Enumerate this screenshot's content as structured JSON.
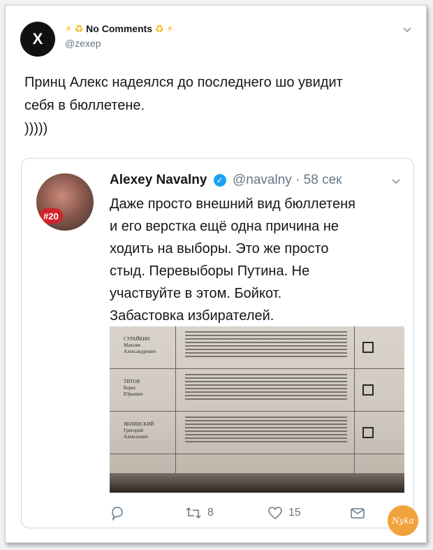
{
  "tweet": {
    "avatar_letter": "X",
    "author_name": "No Comments",
    "author_prefix_emoji": "⚡ ♻",
    "author_suffix_emoji": "♻ ⚡",
    "handle": "@zexep",
    "text_lines": [
      "Принц Алекс надеялся до последнего шо увидит",
      "себя в бюллетене.",
      ")))))"
    ]
  },
  "quoted_tweet": {
    "name": "Alexey Navalny",
    "handle": "@navalny",
    "time": "· 58 сек",
    "avatar_badge": "#20",
    "text_lines": [
      "Даже просто внешний вид бюллетеня",
      "и его верстка ещё одна причина не",
      "ходить на выборы. Это же просто",
      "стыд. Перевыборы Путина. Не",
      "участвуйте в этом. Бойкот.",
      "Забастовка избирателей."
    ],
    "ballot_candidates": [
      [
        "СУРАЙКИН",
        "Максим",
        "Александрович"
      ],
      [
        "ТИТОВ",
        "Борис",
        "Юрьевич"
      ],
      [
        "ЯВЛИНСКИЙ",
        "Григорий",
        "Алексеевич"
      ]
    ],
    "actions": {
      "retweets": "8",
      "likes": "15"
    }
  },
  "watermark": "Nyka",
  "colors": {
    "verified": "#1da1f2",
    "secondary_text": "#657786",
    "border": "#ccd6dd"
  }
}
